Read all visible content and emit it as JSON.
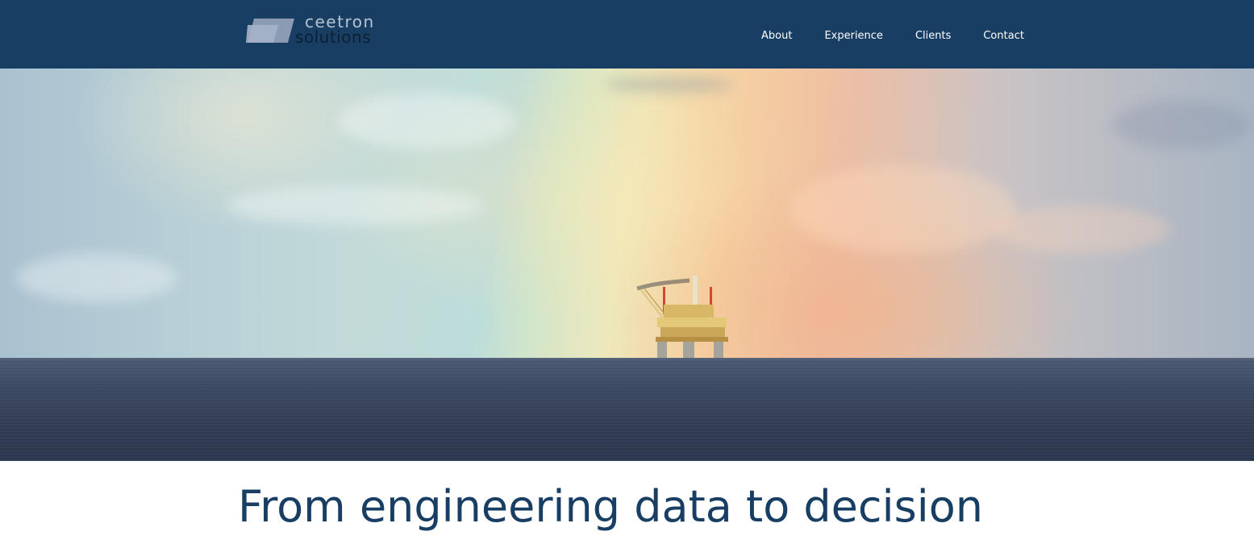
{
  "brand": {
    "line1": "ceetron",
    "line2": "solutions",
    "colors": {
      "header_bg": "#183e63",
      "logo_top": "#b7c3d3",
      "logo_bottom": "#0d1f33",
      "headline": "#183e63"
    }
  },
  "nav": {
    "items": [
      {
        "label": "About"
      },
      {
        "label": "Experience"
      },
      {
        "label": "Clients"
      },
      {
        "label": "Contact"
      }
    ]
  },
  "hero": {
    "image": "offshore-oil-rig-with-rainbow"
  },
  "main": {
    "headline": "From engineering data to decision"
  }
}
